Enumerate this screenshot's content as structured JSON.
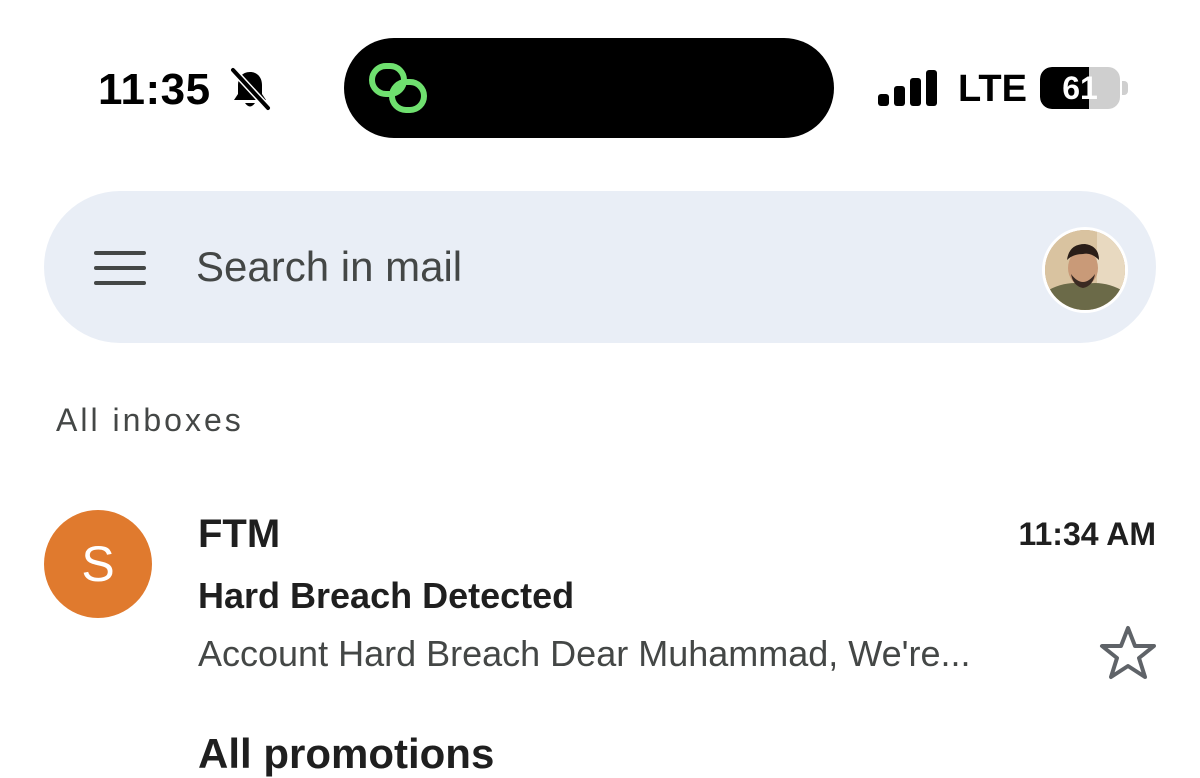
{
  "status_bar": {
    "time": "11:35",
    "network": "LTE",
    "battery_level": "61",
    "battery_fraction": 0.61,
    "silent_icon": "bell-slash-icon",
    "island_icon": "linked-rings-icon",
    "island_icon_color": "#6fe06f"
  },
  "search": {
    "placeholder": "Search in mail",
    "menu_icon": "hamburger-menu-icon"
  },
  "section": {
    "label": "All inboxes"
  },
  "emails": [
    {
      "avatar_letter": "S",
      "avatar_color": "#e07a2e",
      "sender": "FTM",
      "time": "11:34 AM",
      "subject": "Hard Breach Detected",
      "snippet": "Account Hard Breach Dear Muhammad, We're...",
      "starred": false
    }
  ],
  "next_section": {
    "label": "All promotions"
  }
}
